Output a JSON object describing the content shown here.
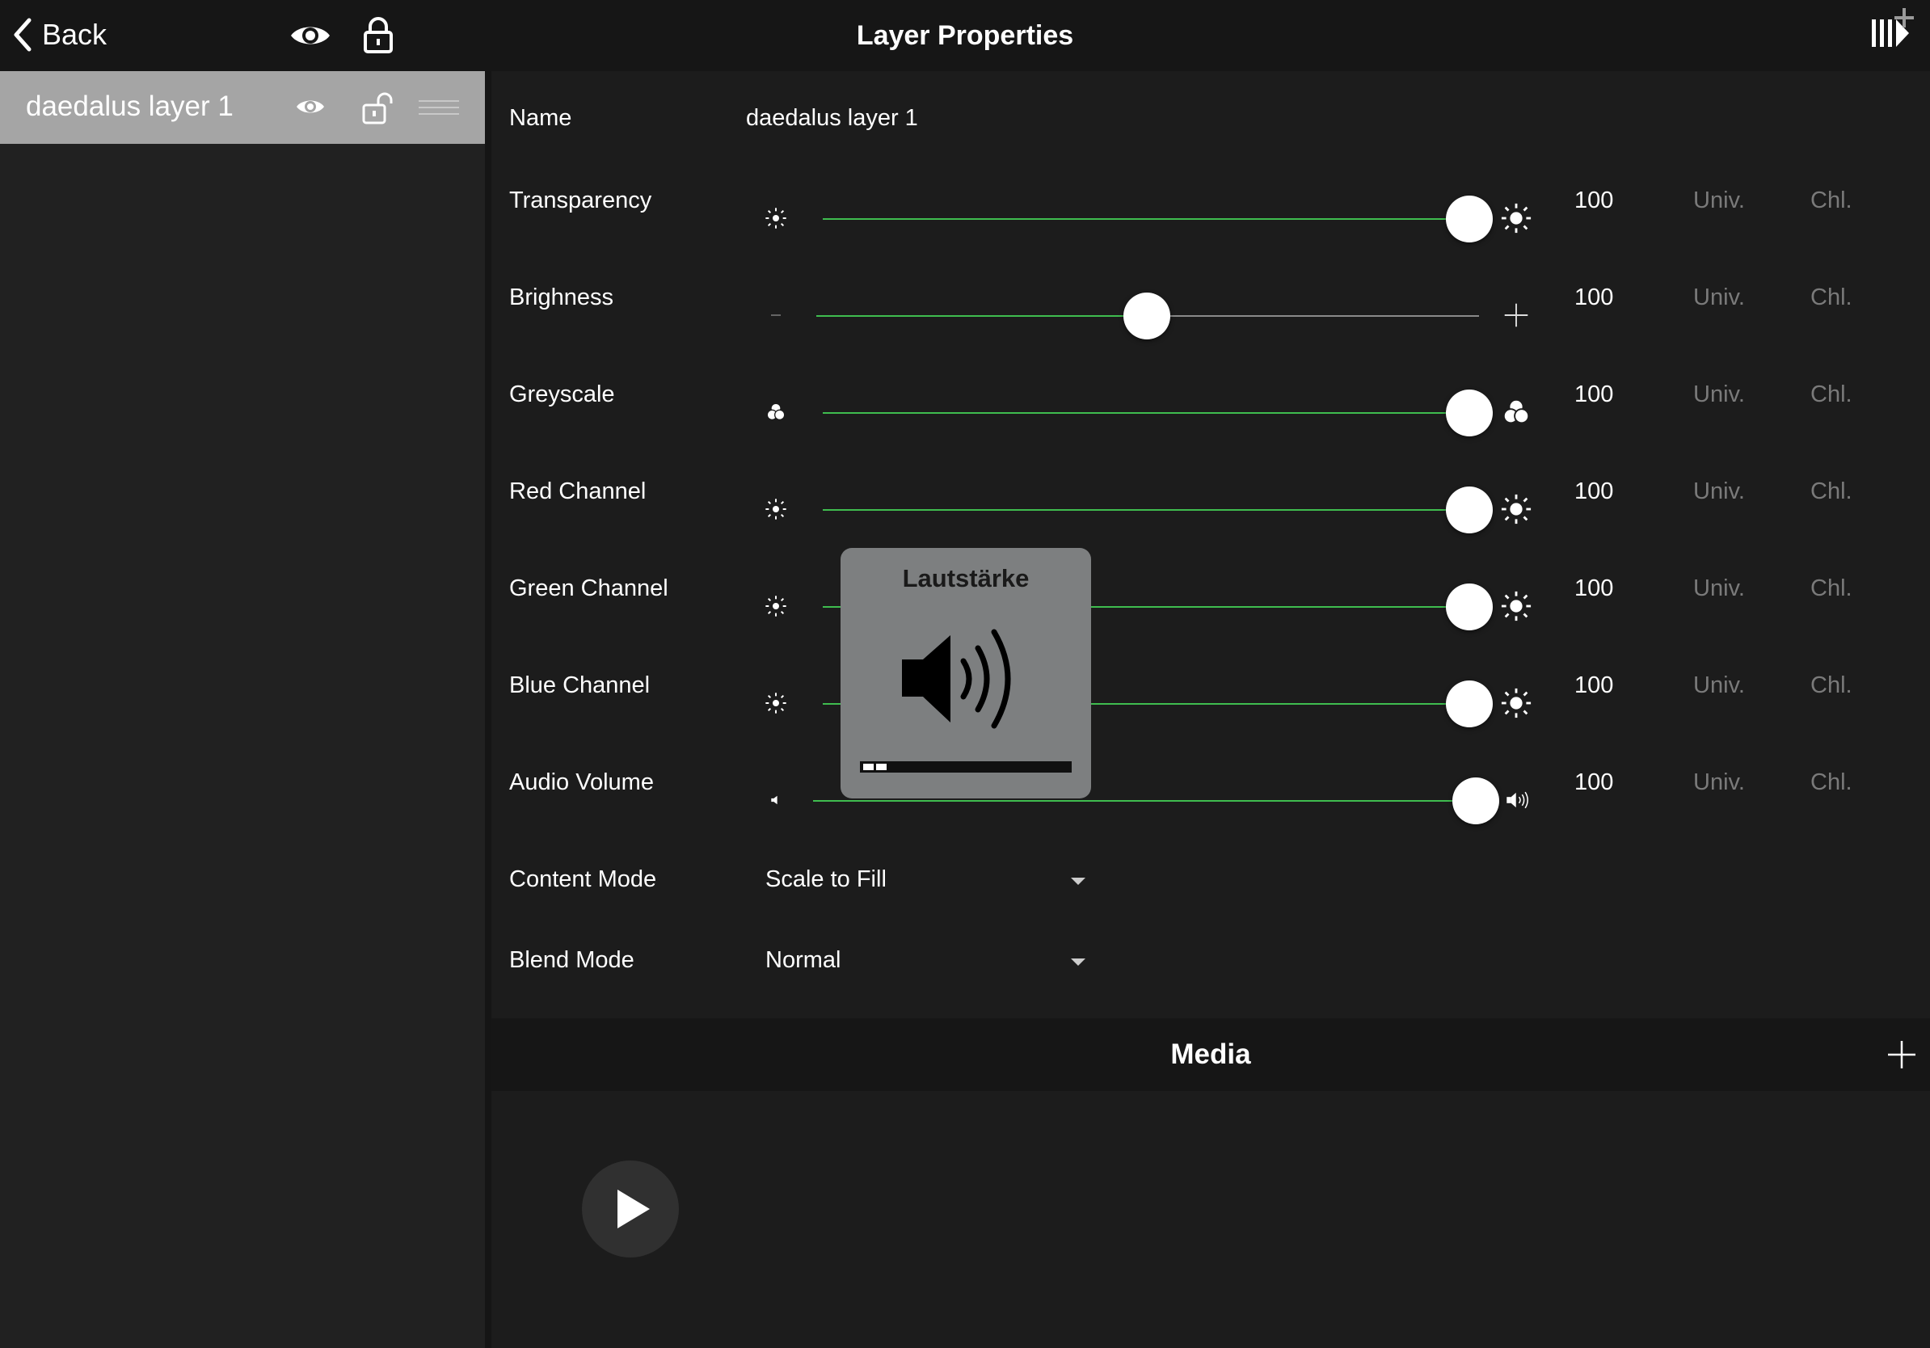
{
  "topbar": {
    "back_label": "Back",
    "title": "Layer Properties"
  },
  "sidebar": {
    "layers": [
      {
        "name": "daedalus layer 1",
        "selected": true
      }
    ]
  },
  "properties": {
    "name_label": "Name",
    "name_value": "daedalus layer 1",
    "sliders": [
      {
        "label": "Transparency",
        "value": "100",
        "fraction": 1.0,
        "min_icon": "sun-small-icon",
        "max_icon": "sun-large-icon",
        "univ": "Univ.",
        "chl": "Chl."
      },
      {
        "label": "Brighness",
        "value": "100",
        "fraction": 0.5,
        "min_icon": "minus-icon",
        "max_icon": "plus-icon",
        "univ": "Univ.",
        "chl": "Chl."
      },
      {
        "label": "Greyscale",
        "value": "100",
        "fraction": 1.0,
        "min_icon": "color-circles-small-icon",
        "max_icon": "color-circles-large-icon",
        "univ": "Univ.",
        "chl": "Chl."
      },
      {
        "label": "Red Channel",
        "value": "100",
        "fraction": 1.0,
        "min_icon": "sun-small-icon",
        "max_icon": "sun-large-icon",
        "univ": "Univ.",
        "chl": "Chl."
      },
      {
        "label": "Green Channel",
        "value": "100",
        "fraction": 1.0,
        "min_icon": "sun-small-icon",
        "max_icon": "sun-large-icon",
        "univ": "Univ.",
        "chl": "Chl."
      },
      {
        "label": "Blue Channel",
        "value": "100",
        "fraction": 1.0,
        "min_icon": "sun-small-icon",
        "max_icon": "sun-large-icon",
        "univ": "Univ.",
        "chl": "Chl."
      },
      {
        "label": "Audio Volume",
        "value": "100",
        "fraction": 1.0,
        "min_icon": "speaker-low-icon",
        "max_icon": "speaker-high-icon",
        "univ": "Univ.",
        "chl": "Chl."
      }
    ],
    "content_mode": {
      "label": "Content Mode",
      "value": "Scale to Fill"
    },
    "blend_mode": {
      "label": "Blend Mode",
      "value": "Normal"
    }
  },
  "media": {
    "title": "Media"
  },
  "volume_hud": {
    "title": "Lautstärke",
    "level_segments": 2
  },
  "colors": {
    "accent_green": "#3fbd4f",
    "selected_layer": "#a5a5a5",
    "hud_background": "#7d7f80"
  }
}
